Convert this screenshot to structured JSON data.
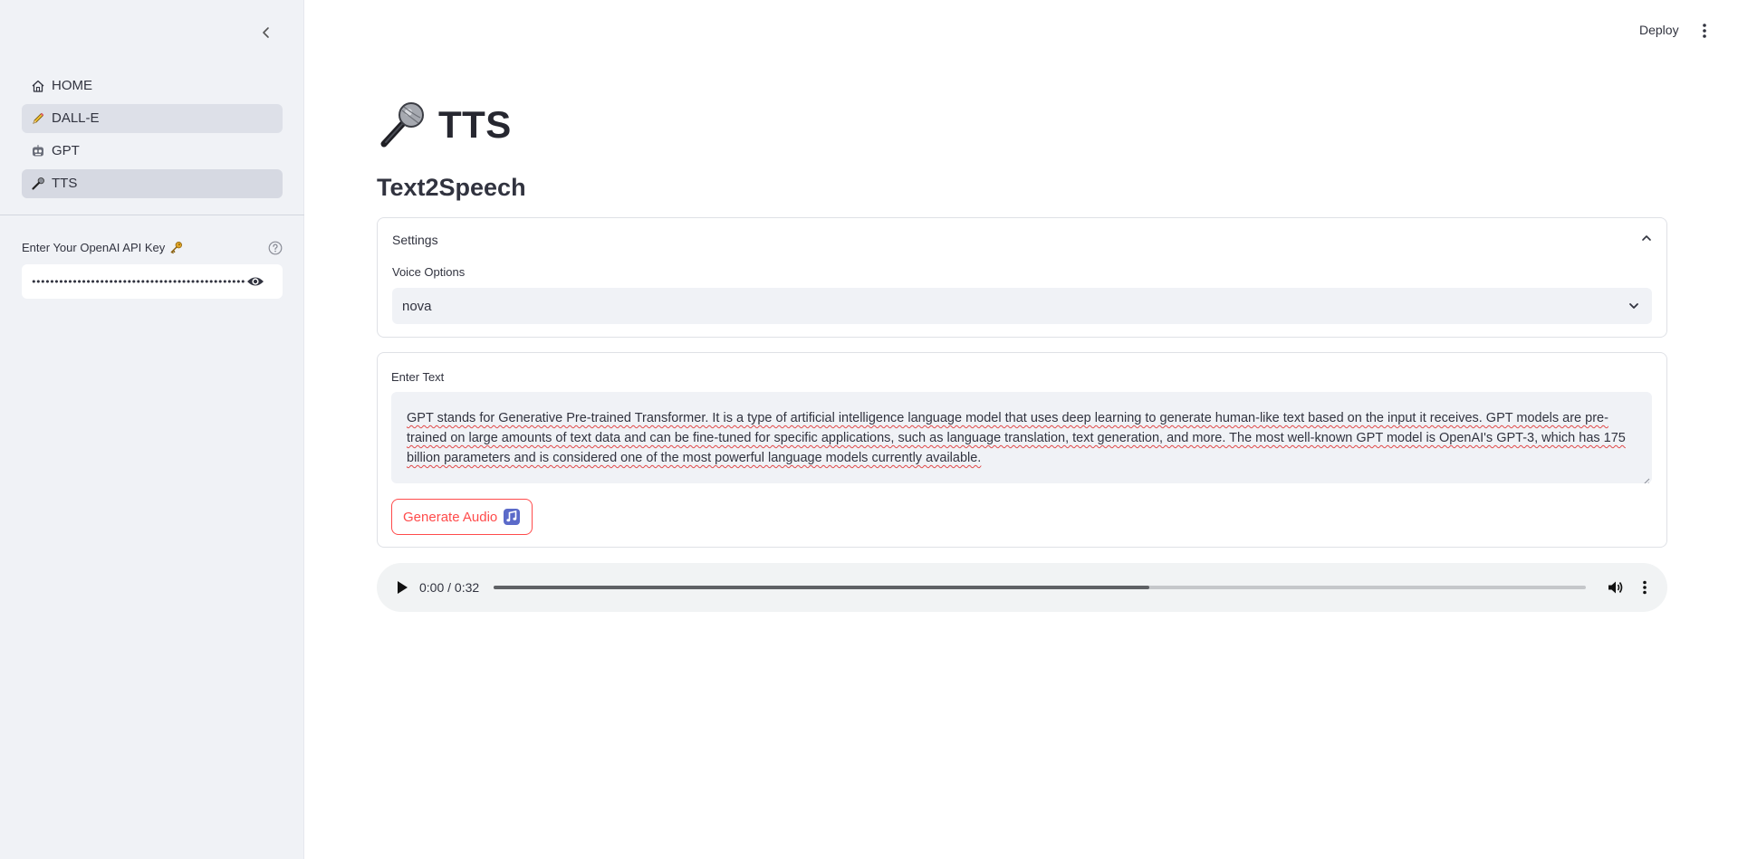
{
  "sidebar": {
    "items": [
      {
        "label": "HOME",
        "icon": "home-icon"
      },
      {
        "label": "DALL-E",
        "icon": "pencil-icon"
      },
      {
        "label": "GPT",
        "icon": "robot-face-icon"
      },
      {
        "label": "TTS",
        "icon": "microphone-icon"
      }
    ],
    "api_key_label": "Enter Your OpenAI API Key",
    "api_key_value": "••••••••••••••••••••••••••••••••••••••••••••••••••••"
  },
  "header": {
    "deploy_label": "Deploy"
  },
  "main": {
    "title": "TTS",
    "subheader": "Text2Speech",
    "settings": {
      "header": "Settings",
      "voice_label": "Voice Options",
      "voice_value": "nova"
    },
    "text_input": {
      "label": "Enter Text",
      "value": "GPT stands for Generative Pre-trained Transformer. It is a type of artificial intelligence language model that uses deep learning to generate human-like text based on the input it receives. GPT models are pre-trained on large amounts of text data and can be fine-tuned for specific applications, such as language translation, text generation, and more. The most well-known GPT model is OpenAI's GPT-3, which has 175 billion parameters and is considered one of the most powerful language models currently available."
    },
    "generate_button_label": "Generate Audio",
    "audio": {
      "time": "0:00 / 0:32",
      "buffered_fraction": 0.6
    }
  },
  "colors": {
    "primary": "#ff4b4b",
    "sidebar_bg": "#f0f2f6",
    "text": "#31333f"
  }
}
